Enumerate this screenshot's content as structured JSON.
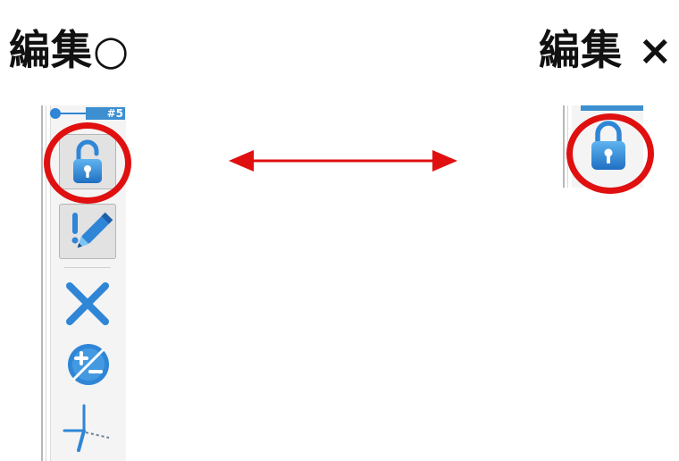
{
  "headings": {
    "left": "編集○",
    "right": "編集 ×"
  },
  "toolbar": {
    "tab_label": "#5",
    "buttons": [
      {
        "name": "unlocked-lock",
        "icon": "lock-open-icon"
      },
      {
        "name": "edit",
        "icon": "exclamation-pencil-icon"
      },
      {
        "name": "close",
        "icon": "close-x-icon"
      },
      {
        "name": "plus-minus",
        "icon": "plus-minus-circle-icon"
      },
      {
        "name": "axes",
        "icon": "axes-icon"
      }
    ]
  },
  "right_fragment": {
    "button": {
      "name": "locked-lock",
      "icon": "lock-closed-icon"
    }
  },
  "colors": {
    "highlight_red": "#e01010",
    "icon_blue": "#2f86d6",
    "icon_blue_light": "#5fb4f0"
  }
}
